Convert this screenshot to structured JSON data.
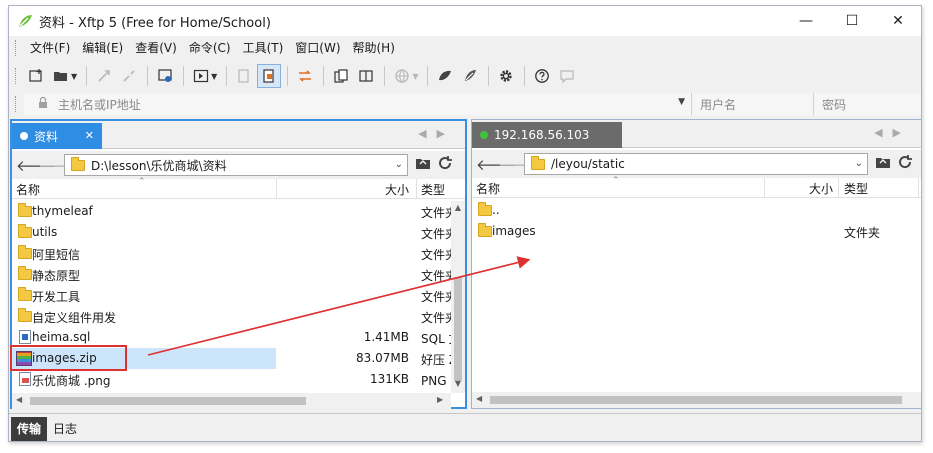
{
  "window": {
    "title": "资料 - Xftp 5 (Free for Home/School)",
    "controls": {
      "minimize": "—",
      "maximize": "☐",
      "close": "✕"
    }
  },
  "menu": [
    "文件(F)",
    "编辑(E)",
    "查看(V)",
    "命令(C)",
    "工具(T)",
    "窗口(W)",
    "帮助(H)"
  ],
  "address": {
    "host_placeholder": "主机名或IP地址",
    "user_placeholder": "用户名",
    "password_placeholder": "密码"
  },
  "left_pane": {
    "tab_label": "资料",
    "path": "D:\\lesson\\乐优商城\\资料",
    "columns": {
      "name": "名称",
      "size": "大小",
      "type": "类型"
    },
    "rows": [
      {
        "name": "thymeleaf",
        "size": "",
        "type": "文件夹",
        "kind": "folder"
      },
      {
        "name": "utils",
        "size": "",
        "type": "文件夹",
        "kind": "folder"
      },
      {
        "name": "阿里短信",
        "size": "",
        "type": "文件夹",
        "kind": "folder"
      },
      {
        "name": "静态原型",
        "size": "",
        "type": "文件夹",
        "kind": "folder"
      },
      {
        "name": "开发工具",
        "size": "",
        "type": "文件夹",
        "kind": "folder"
      },
      {
        "name": "自定义组件用发",
        "size": "",
        "type": "文件夹",
        "kind": "folder"
      },
      {
        "name": "heima.sql",
        "size": "1.41MB",
        "type": "SQL 文件",
        "kind": "sql"
      },
      {
        "name": "images.zip",
        "size": "83.07MB",
        "type": "好压 ZIP 压缩文件",
        "kind": "zip"
      },
      {
        "name": "乐优商城 .png",
        "size": "131KB",
        "type": "PNG 文件",
        "kind": "png"
      }
    ]
  },
  "right_pane": {
    "tab_label": "192.168.56.103",
    "path": "/leyou/static",
    "columns": {
      "name": "名称",
      "size": "大小",
      "type": "类型"
    },
    "rows": [
      {
        "name": "..",
        "size": "",
        "type": "",
        "kind": "folder"
      },
      {
        "name": "images",
        "size": "",
        "type": "文件夹",
        "kind": "folder"
      }
    ]
  },
  "bottom_tabs": [
    "传输",
    "日志"
  ],
  "colors": {
    "active_tab": "#2f8de4",
    "remote_tab": "#6b6b6b",
    "connected_dot": "#3fc03f",
    "highlight": "#e03030",
    "selection": "#cce5fb"
  },
  "icons": {
    "toolbar": [
      "new-session-icon",
      "open-folder-icon",
      "connect-icon",
      "disconnect-icon",
      "session-settings-icon",
      "terminal-icon",
      "copy-icon",
      "paste-icon",
      "transfer-icon",
      "new-window-icon",
      "web-icon",
      "xshell-icon",
      "xmanager-icon",
      "settings-gear-icon",
      "help-icon",
      "chat-icon"
    ]
  }
}
